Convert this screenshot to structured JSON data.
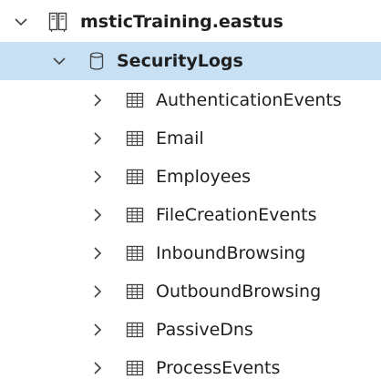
{
  "tree": {
    "cluster": {
      "label": "msticTraining.eastus",
      "icon": "server-cluster-icon",
      "expanded": true
    },
    "database": {
      "label": "SecurityLogs",
      "icon": "database-icon",
      "expanded": true,
      "selected": true
    },
    "tables": [
      {
        "label": "AuthenticationEvents",
        "icon": "table-icon"
      },
      {
        "label": "Email",
        "icon": "table-icon"
      },
      {
        "label": "Employees",
        "icon": "table-icon"
      },
      {
        "label": "FileCreationEvents",
        "icon": "table-icon"
      },
      {
        "label": "InboundBrowsing",
        "icon": "table-icon"
      },
      {
        "label": "OutboundBrowsing",
        "icon": "table-icon"
      },
      {
        "label": "PassiveDns",
        "icon": "table-icon"
      },
      {
        "label": "ProcessEvents",
        "icon": "table-icon"
      }
    ]
  },
  "colors": {
    "selected_row": "#c7e0f4",
    "text": "#1f1f1f",
    "icon": "#424242"
  }
}
